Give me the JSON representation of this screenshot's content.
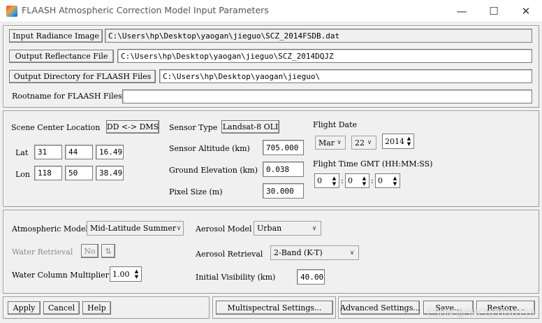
{
  "window": {
    "title": "FLAASH Atmospheric Correction Model Input Parameters",
    "minimize": "—",
    "maximize": "☐",
    "close": "✕"
  },
  "files": {
    "input_radiance_label": "Input Radiance Image",
    "input_radiance_value": "C:\\Users\\hp\\Desktop\\yaogan\\jieguo\\SCZ_2014FSDB.dat",
    "output_reflectance_label": "Output Reflectance File",
    "output_reflectance_value": "C:\\Users\\hp\\Desktop\\yaogan\\jieguo\\SCZ_2014DQJZ",
    "output_directory_label": "Output Directory for FLAASH Files",
    "output_directory_value": "C:\\Users\\hp\\Desktop\\yaogan\\jieguo\\",
    "rootname_label": "Rootname for FLAASH Files",
    "rootname_value": ""
  },
  "scene": {
    "center_label": "Scene Center Location",
    "dd_dms_button": "DD <-> DMS",
    "lat_label": "Lat",
    "lat": [
      "31",
      "44",
      "16.49"
    ],
    "lon_label": "Lon",
    "lon": [
      "118",
      "50",
      "38.49"
    ]
  },
  "sensor": {
    "type_label": "Sensor Type",
    "type_value": "Landsat-8 OLI",
    "altitude_label": "Sensor Altitude (km)",
    "altitude_value": "705.000",
    "ground_label": "Ground Elevation (km)",
    "ground_value": "0.038",
    "pixel_label": "Pixel Size (m)",
    "pixel_value": "30.000"
  },
  "flight": {
    "date_label": "Flight Date",
    "month": "Mar",
    "day": "22",
    "year": "2014",
    "time_label": "Flight Time GMT (HH:MM:SS)",
    "hh": "0",
    "mm": "0",
    "ss": "0",
    "sep": ":"
  },
  "atmosphere": {
    "model_label": "Atmospheric Model",
    "model_value": "Mid-Latitude Summer",
    "water_retrieval_label": "Water Retrieval",
    "water_retrieval_value": "No",
    "water_column_label": "Water Column Multiplier",
    "water_column_value": "1.00",
    "aerosol_model_label": "Aerosol Model",
    "aerosol_model_value": "Urban",
    "aerosol_retrieval_label": "Aerosol Retrieval",
    "aerosol_retrieval_value": "2-Band (K-T)",
    "visibility_label": "Initial Visibility (km)",
    "visibility_value": "40.00"
  },
  "actions": {
    "apply": "Apply",
    "cancel": "Cancel",
    "help": "Help",
    "multispectral": "Multispectral Settings...",
    "advanced": "Advanced Settings...",
    "save": "Save...",
    "restore": "Restore..."
  },
  "watermark": "CSDN @SHCHZHOU110",
  "icons": {
    "app": "envi-app-icon",
    "toggle": "toggle-arrows-icon",
    "chevron": "chevron-down-icon",
    "spin": "spin-arrows-icon"
  }
}
